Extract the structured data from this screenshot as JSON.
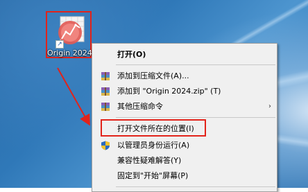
{
  "desktop_icon": {
    "label": "Origin 2024"
  },
  "context_menu": {
    "items": [
      {
        "label": "打开(O)",
        "bold": true,
        "icon": "none"
      },
      {
        "label": "添加到压缩文件(A)...",
        "icon": "winrar-archive-icon"
      },
      {
        "label": "添加到 \"Origin 2024.zip\" (T)",
        "icon": "winrar-archive-icon"
      },
      {
        "label": "其他压缩命令",
        "icon": "winrar-archive-icon",
        "submenu": "›"
      },
      {
        "label": "打开文件所在的位置(I)",
        "icon": "none"
      },
      {
        "label": "以管理员身份运行(A)",
        "icon": "uac-shield-icon"
      },
      {
        "label": "兼容性疑难解答(Y)",
        "icon": "none"
      },
      {
        "label": "固定到\"开始\"屏幕(P)",
        "icon": "none"
      }
    ]
  },
  "colors": {
    "annotation_red": "#e2231a",
    "menu_background": "#f0f0f0"
  }
}
